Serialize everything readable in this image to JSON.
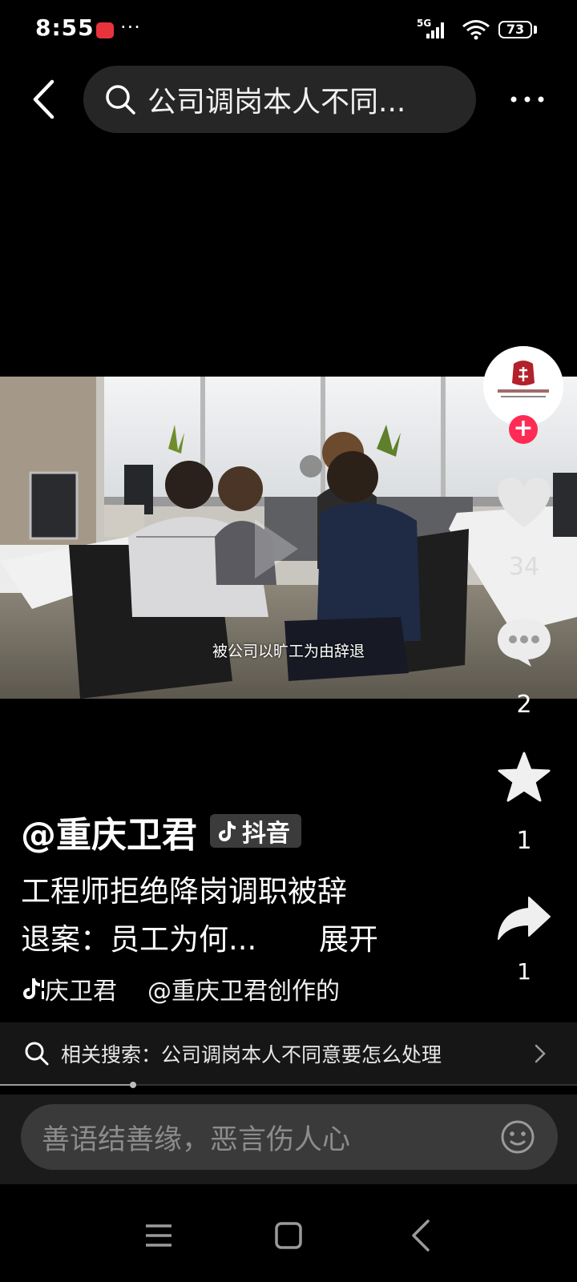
{
  "status_bar": {
    "time": "8:55",
    "dots": "···",
    "network": "5G",
    "battery": "73"
  },
  "top_bar": {
    "search_query": "公司调岗本人不同..."
  },
  "video": {
    "subtitle": "被公司以旷工为由辞退"
  },
  "rail": {
    "likes": "34",
    "comments": "2",
    "favorites": "1",
    "shares": "1"
  },
  "caption": {
    "author": "@重庆卫君",
    "badge_label": "抖音",
    "line1": "工程师拒绝降岗调职被辞",
    "line2": "退案：员工为何...",
    "expand": "展开",
    "music_author": "庆卫君",
    "music_source": "@重庆卫君创作的"
  },
  "related_search": {
    "text": "相关搜索：公司调岗本人不同意要怎么处理"
  },
  "progress": {
    "fraction": 0.23
  },
  "comment_bar": {
    "placeholder": "善语结善缘，恶言伤人心"
  },
  "colors": {
    "accent": "#fe2c55",
    "background": "#000000",
    "search_bg": "#262626"
  }
}
